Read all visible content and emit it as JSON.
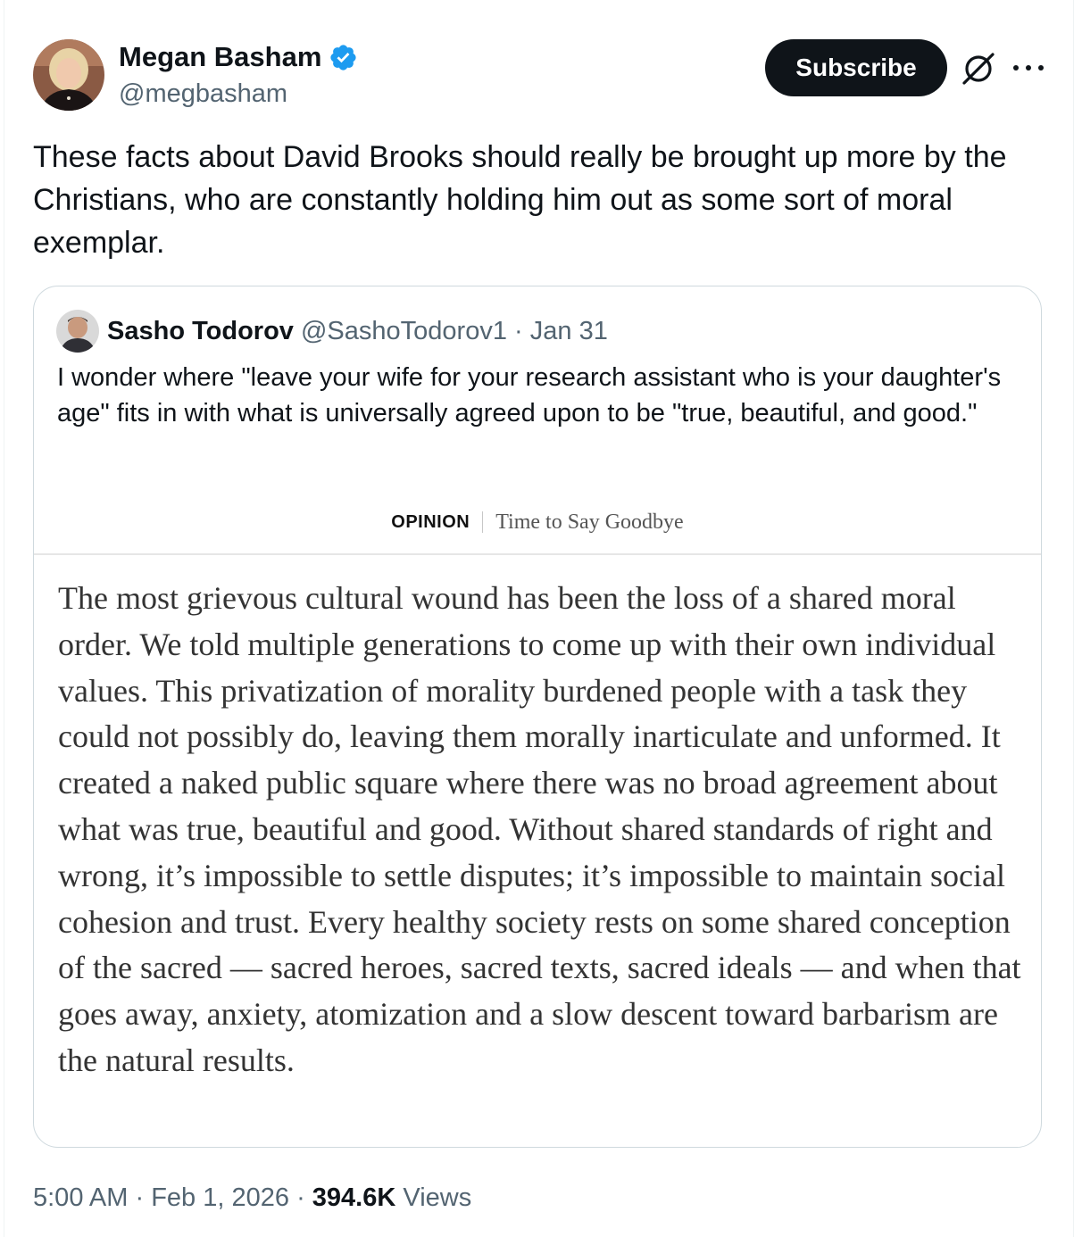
{
  "author": {
    "display_name": "Megan Basham",
    "handle": "@megbasham",
    "verified": true,
    "verified_color": "#1d9bf0"
  },
  "actions": {
    "subscribe_label": "Subscribe",
    "grok_icon": "grok-icon",
    "more_icon": "more-icon"
  },
  "tweet": {
    "text": "These facts about David Brooks should really be brought up more by the Christians, who are constantly holding him out as some sort of moral exemplar."
  },
  "quote": {
    "display_name": "Sasho Todorov",
    "handle": "@SashoTodorov1",
    "separator": "·",
    "date": "Jan 31",
    "text": "I wonder where \"leave your wife for your research assistant who is your daughter's age\" fits in with what is universally agreed upon to be \"true, beautiful, and good.\"",
    "article": {
      "section": "OPINION",
      "title": "Time to Say Goodbye",
      "body": "The most grievous cultural wound has been the loss of a shared moral order. We told multiple generations to come up with their own individual values. This privatization of morality burdened people with a task they could not possibly do, leaving them morally inarticulate and unformed. It created a naked public square where there was no broad agreement about what was true, beautiful and good. Without shared standards of right and wrong, it’s impossible to settle disputes; it’s impossible to maintain social cohesion and trust. Every healthy society rests on some shared conception of the sacred — sacred heroes, sacred texts, sacred ideals — and when that goes away, anxiety, atomization and a slow descent toward barbarism are the natural results."
    }
  },
  "footer": {
    "time": "5:00 AM",
    "dot1": "·",
    "date": "Feb 1, 2026",
    "dot2": "·",
    "views_count": "394.6K",
    "views_label": "Views"
  },
  "colors": {
    "text_primary": "#0f1419",
    "text_secondary": "#536471",
    "border": "#cfd9de",
    "button_bg": "#0f1419"
  }
}
